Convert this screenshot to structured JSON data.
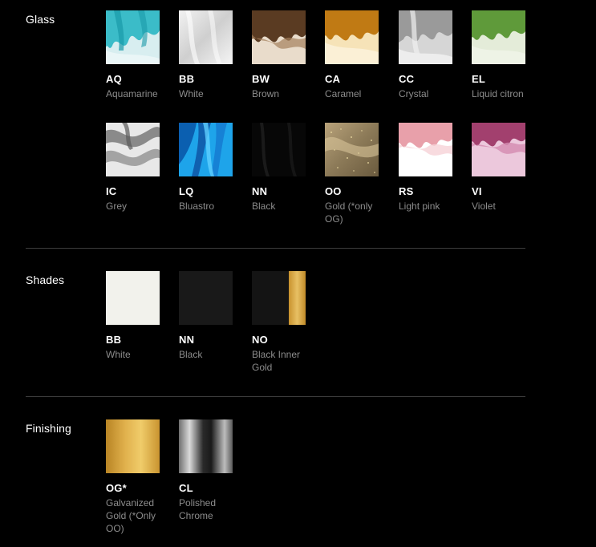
{
  "glass": {
    "title": "Glass",
    "items": [
      {
        "code": "AQ",
        "name": "Aquamarine"
      },
      {
        "code": "BB",
        "name": "White"
      },
      {
        "code": "BW",
        "name": "Brown"
      },
      {
        "code": "CA",
        "name": "Caramel"
      },
      {
        "code": "CC",
        "name": "Crystal"
      },
      {
        "code": "EL",
        "name": "Liquid citron"
      },
      {
        "code": "IC",
        "name": "Grey"
      },
      {
        "code": "LQ",
        "name": "Bluastro"
      },
      {
        "code": "NN",
        "name": "Black"
      },
      {
        "code": "OO",
        "name": "Gold (*only OG)"
      },
      {
        "code": "RS",
        "name": "Light pink"
      },
      {
        "code": "VI",
        "name": "Violet"
      }
    ]
  },
  "shades": {
    "title": "Shades",
    "items": [
      {
        "code": "BB",
        "name": "White"
      },
      {
        "code": "NN",
        "name": "Black"
      },
      {
        "code": "NO",
        "name": "Black Inner Gold"
      }
    ]
  },
  "finishing": {
    "title": "Finishing",
    "items": [
      {
        "code": "OG*",
        "name": "Galvanized Gold (*Only OO)"
      },
      {
        "code": "CL",
        "name": "Polished Chrome"
      }
    ]
  },
  "colors": {
    "background": "#000000",
    "divider": "#3d3d3d",
    "label_muted": "#8c8c8c"
  }
}
